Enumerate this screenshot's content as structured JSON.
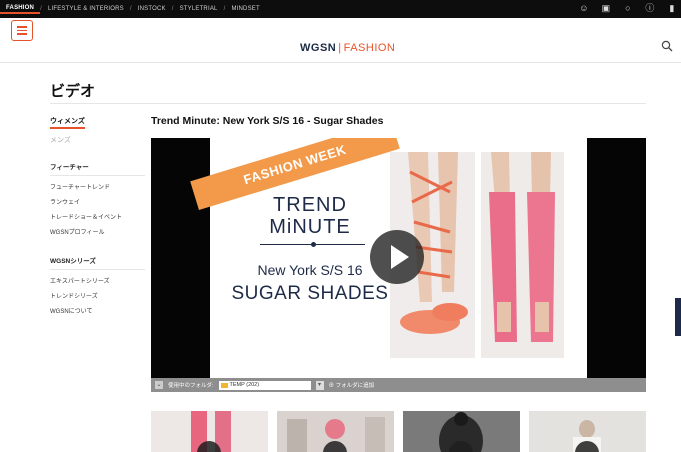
{
  "topnav": {
    "items": [
      "FASHION",
      "LIFESTYLE & INTERIORS",
      "INSTOCK",
      "STYLETRIAL",
      "MINDSET"
    ],
    "separator": "/",
    "icons": [
      "user-icon",
      "briefcase-icon",
      "chat-icon",
      "info-icon",
      "more-icon"
    ]
  },
  "header": {
    "logo_main": "WGSN",
    "logo_sep": "|",
    "logo_sub": "FASHION"
  },
  "page": {
    "title": "ビデオ"
  },
  "sidebar": {
    "active": "ウィメンズ",
    "mens": "メンズ",
    "features_head": "フィーチャー",
    "features": [
      "フューチャートレンド",
      "ランウェイ",
      "トレードショー＆イベント",
      "WGSNプロフィール"
    ],
    "series_head": "WGSNシリーズ",
    "series": [
      "エキスパートシリーズ",
      "トレンドシリーズ",
      "WGSNについて"
    ]
  },
  "video": {
    "title": "Trend Minute: New York S/S 16 - Sugar Shades",
    "banner": "FASHION WEEK",
    "tm_line1": "TREND",
    "tm_line2": "MiNUTE",
    "sub1": "New York S/S 16",
    "sub2": "SUGAR SHADES"
  },
  "folder": {
    "label": "使用中のフォルダ:",
    "value": "TEMP (202)",
    "add": "フォルダに追加"
  },
  "colors": {
    "accent": "#e8522a",
    "navy": "#1e2b48",
    "banner": "#f29a4a"
  }
}
